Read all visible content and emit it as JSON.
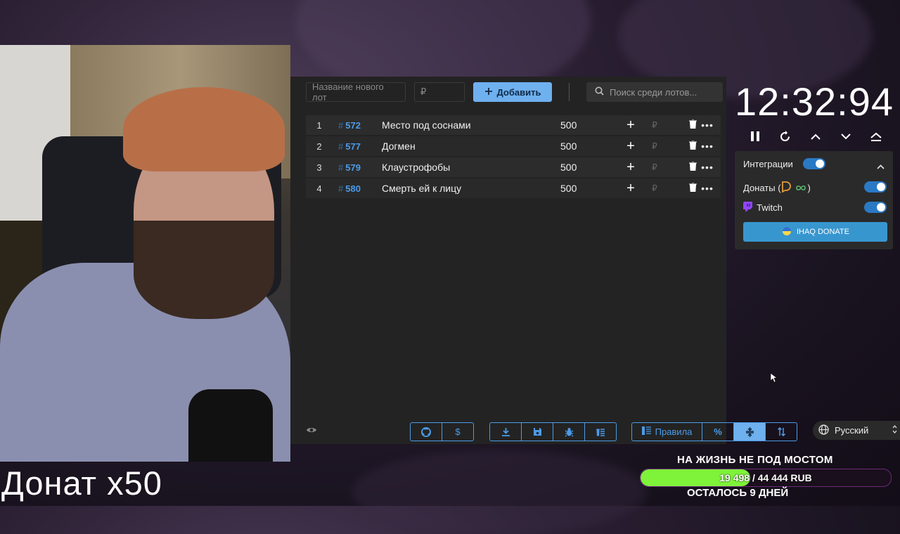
{
  "overlay": {
    "donate_multiplier": "Донат x50"
  },
  "toolbar": {
    "new_lot_placeholder": "Название нового лот",
    "amount_placeholder": "₽",
    "add_label": "Добавить",
    "search_placeholder": "Поиск среди лотов..."
  },
  "lots": [
    {
      "index": "1",
      "id": "572",
      "name": "Место под соснами",
      "amount": "500",
      "currency": "₽"
    },
    {
      "index": "2",
      "id": "577",
      "name": "Догмен",
      "amount": "500",
      "currency": "₽"
    },
    {
      "index": "3",
      "id": "579",
      "name": "Клаустрофобы",
      "amount": "500",
      "currency": "₽"
    },
    {
      "index": "4",
      "id": "580",
      "name": "Смерть ей к лицу",
      "amount": "500",
      "currency": "₽"
    }
  ],
  "bottom_bar": {
    "rules_label": "Правила",
    "percent_label": "%"
  },
  "timer": {
    "value": "12:32:94"
  },
  "integrations": {
    "title": "Интеграции",
    "donations_label": "Донаты (",
    "donations_suffix": ")",
    "twitch_label": "Twitch",
    "ihaq_label": "IHAQ DONATE",
    "integrations_enabled": true,
    "donations_enabled": true,
    "twitch_enabled": true
  },
  "language": {
    "selected": "Русский"
  },
  "goal": {
    "title": "НА ЖИЗНЬ НЕ ПОД МОСТОМ",
    "progress_text": "19 498 / 44 444 RUB",
    "current": 19498,
    "target": 44444,
    "remaining": "ОСТАЛОСЬ 9 ДНЕЙ"
  },
  "colors": {
    "accent": "#6fb0ef",
    "id_blue": "#4c9be8",
    "goal_fill": "#7ff23a",
    "twitch": "#9146ff"
  }
}
